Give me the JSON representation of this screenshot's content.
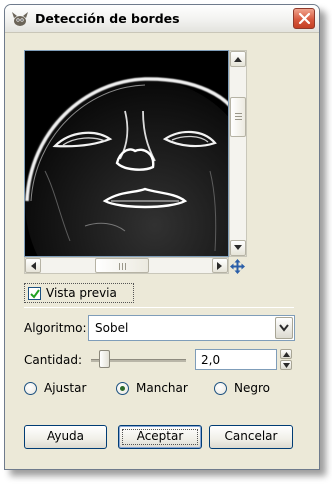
{
  "window": {
    "title": "Detección de bordes",
    "app_icon": "gimp-wilber-icon",
    "close_icon": "close-icon"
  },
  "preview": {
    "show_preview_label": "Vista previa",
    "show_preview_checked": true,
    "navigate_icon": "four-way-arrow-icon"
  },
  "algorithm": {
    "label": "Algoritmo:",
    "value": "Sobel"
  },
  "amount": {
    "label": "Cantidad:",
    "value": "2,0",
    "slider_level": 0.08
  },
  "edge_mode": {
    "options": [
      {
        "label": "Ajustar",
        "selected": false
      },
      {
        "label": "Manchar",
        "selected": true
      },
      {
        "label": "Negro",
        "selected": false
      }
    ]
  },
  "buttons": {
    "help": "Ayuda",
    "ok": "Aceptar",
    "cancel": "Cancelar"
  },
  "colors": {
    "title_close": "#d7593f",
    "focus_border": "#003c74",
    "dialog_bg": "#ece9d8"
  }
}
